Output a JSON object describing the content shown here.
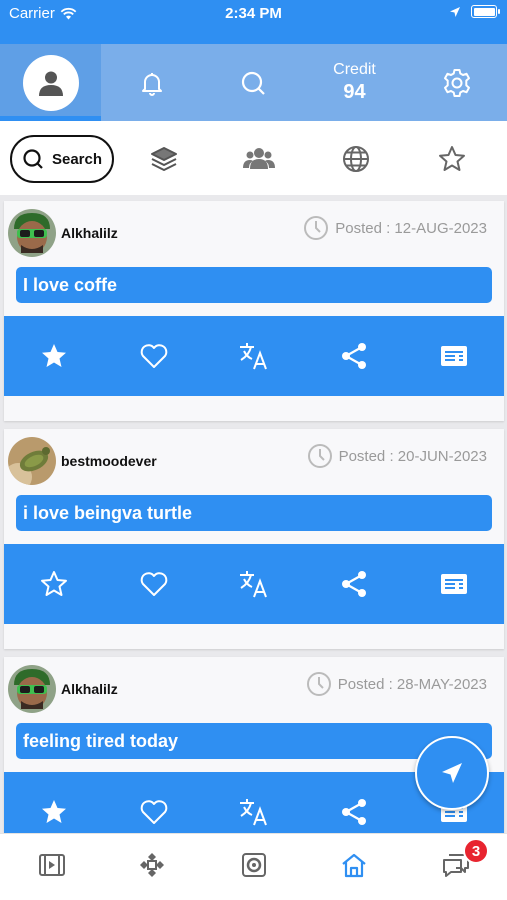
{
  "status_bar": {
    "carrier": "Carrier",
    "time": "2:34 PM"
  },
  "header": {
    "tabs": [
      {
        "icon": "profile-icon",
        "active": true
      },
      {
        "icon": "bell-icon"
      },
      {
        "icon": "search-icon"
      },
      {
        "icon": "credit"
      },
      {
        "icon": "gear-icon"
      }
    ],
    "credit_label": "Credit",
    "credit_value": "94"
  },
  "filters": {
    "search_label": "Search",
    "icons": [
      "layers-icon",
      "group-icon",
      "globe-icon",
      "star-outline-icon"
    ]
  },
  "posts": [
    {
      "username": "Alkhalilz",
      "date": "Posted : 12-AUG-2023",
      "text": "I love coffe",
      "starred": true,
      "avatar": "man-green-glasses"
    },
    {
      "username": "bestmoodever",
      "date": "Posted : 20-JUN-2023",
      "text": "i love beingva turtle",
      "starred": false,
      "avatar": "turtle"
    },
    {
      "username": "Alkhalilz",
      "date": "Posted : 28-MAY-2023",
      "text": "feeling tired today",
      "starred": true,
      "avatar": "man-green-glasses"
    }
  ],
  "bottom_nav": {
    "items": [
      "video-icon",
      "puzzle-icon",
      "camera-icon",
      "home-icon",
      "chat-icon"
    ],
    "active": "home-icon",
    "badge_count": "3"
  },
  "colors": {
    "primary": "#2f8ff2",
    "header": "#7aaeea",
    "badge": "#e8242f"
  }
}
